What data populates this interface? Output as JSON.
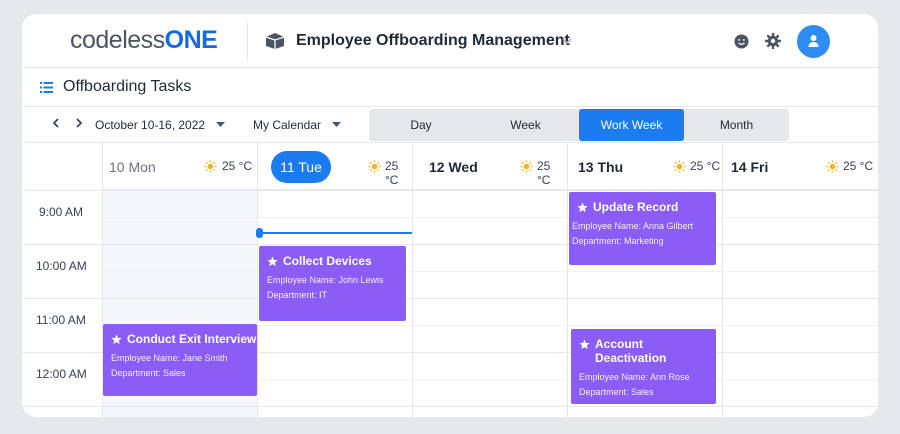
{
  "header": {
    "logo_text": "codeless",
    "logo_accent": "ONE",
    "app_title": "Employee Offboarding Management",
    "icons": [
      "package-icon",
      "chevron-down-icon",
      "smile-icon",
      "gear-icon",
      "user-icon"
    ]
  },
  "subheader": {
    "title": "Offboarding Tasks",
    "icon": "list-icon"
  },
  "toolbar": {
    "date_range": "October 10-16, 2022",
    "calendar": "My Calendar",
    "views": [
      "Day",
      "Week",
      "Work Week",
      "Month"
    ],
    "active_view": "Work Week"
  },
  "days": [
    {
      "label": "10 Mon",
      "temp": "25 °C",
      "today": false
    },
    {
      "label": "11 Tue",
      "temp": "25 °C",
      "today": true
    },
    {
      "label": "12 Wed",
      "temp": "25 °C",
      "today": false
    },
    {
      "label": "13 Thu",
      "temp": "25 °C",
      "today": false
    },
    {
      "label": "14 Fri",
      "temp": "25 °C",
      "today": false
    }
  ],
  "times": [
    "9:00 AM",
    "10:00 AM",
    "11:00 AM",
    "12:00 AM"
  ],
  "events": [
    {
      "title": "Update Record",
      "employee": "Employee Name: Anna Gilbert",
      "department": "Department: Marketing"
    },
    {
      "title": "Collect Devices",
      "employee": "Employee Name: John Lewis",
      "department": "Department: IT"
    },
    {
      "title": "Conduct Exit Interview",
      "employee": "Employee Name: Jane Smith",
      "department": "Department: Sales"
    },
    {
      "title": "Account Deactivation",
      "employee": "Employee Name: Ann Rose",
      "department": "Department: Sales"
    }
  ],
  "colors": {
    "accent": "#1a7cf0",
    "event": "#8b5cf6",
    "sun": "#f5b323"
  }
}
